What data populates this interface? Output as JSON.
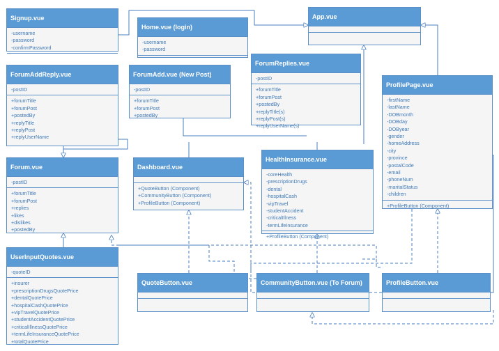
{
  "colors": {
    "header": "#5b9bd5",
    "border": "#5b8fc7",
    "text": "#3f79b8",
    "body": "#f5f5f5",
    "edge": "#4a7ebf"
  },
  "classes": {
    "signup": {
      "name": "Signup.vue",
      "attributes": [
        "-username",
        "-password",
        "-confirmPassword"
      ],
      "methods": []
    },
    "home": {
      "name": "Home.vue (login)",
      "attributes": [
        "-username",
        "-password"
      ],
      "methods": []
    },
    "app": {
      "name": "App.vue",
      "attributes": [],
      "methods": []
    },
    "forumAddReply": {
      "name": "ForumAddReply.vue",
      "attributes": [
        "-postID"
      ],
      "methods": [
        "+forumTitle",
        "+forumPost",
        "+postedBy",
        "+replyTitle",
        "+replyPost",
        "+replyUserName"
      ]
    },
    "forumAdd": {
      "name": "ForumAdd.vue (New Post)",
      "attributes": [
        "-postID"
      ],
      "methods": [
        "+forumTitle",
        "+forumPost",
        "+postedBy"
      ]
    },
    "forumReplies": {
      "name": "ForumReplies.vue",
      "attributes": [
        "-postID"
      ],
      "methods": [
        "+forumTitle",
        "+forumPost",
        "+postedBy",
        "+replyTitle(s)",
        "+replyPost(s)",
        "+replyUserName(s)"
      ]
    },
    "profilePage": {
      "name": "ProfilePage.vue",
      "attributes": [
        "-firstName",
        "-lastName",
        "-DOBmonth",
        "-DOBday",
        "-DOByear",
        "-gender",
        "-homeAddress",
        "-city",
        "-province",
        "-postalCode",
        "-email",
        "-phoneNum",
        "-maritalStatus",
        "-children"
      ],
      "methods": [
        "+ProfileButton (Component)"
      ]
    },
    "forum": {
      "name": "Forum.vue",
      "attributes": [
        "-postID"
      ],
      "methods": [
        "+forumTitle",
        "+forumPost",
        "+replies",
        "+likes",
        "+dislikes",
        "+postedBy"
      ]
    },
    "dashboard": {
      "name": "Dashboard.vue",
      "attributes": [],
      "methods": [
        "+QuoteButton (Component)",
        "+CommunityButton (Component)",
        "+ProfileButton (Component)"
      ]
    },
    "healthInsurance": {
      "name": "HealthInsurance.vue",
      "attributes": [
        "-coreHealth",
        "-prescriptionDrugs",
        "-dental",
        "-hospitalCash",
        "-vipTravel",
        "-studentAccident",
        "-criticalIllness",
        "-termLifeInsurance"
      ],
      "methods": [
        "+ProfileButton (Component)"
      ]
    },
    "userInputQuotes": {
      "name": "UserInputQuotes.vue",
      "attributes": [
        "-quoteID"
      ],
      "methods": [
        "+insurer",
        "+prescriptionDrugsQuotePrice",
        "+dentalQuotePrice",
        "+hospitalCashQuotePrice",
        "+vipTravelQuotePrice",
        "+studentAccidentQuotePrice",
        "+criticalIllnessQuotePrice",
        "+termLifeInsuranceQuotePrice",
        "+totalQuotePrice"
      ]
    },
    "quoteButton": {
      "name": "QuoteButton.vue",
      "attributes": [],
      "methods": []
    },
    "communityButton": {
      "name": "CommunityButton.vue (To Forum)",
      "attributes": [],
      "methods": []
    },
    "profileButton": {
      "name": "ProfileButton.vue",
      "attributes": [],
      "methods": []
    }
  }
}
